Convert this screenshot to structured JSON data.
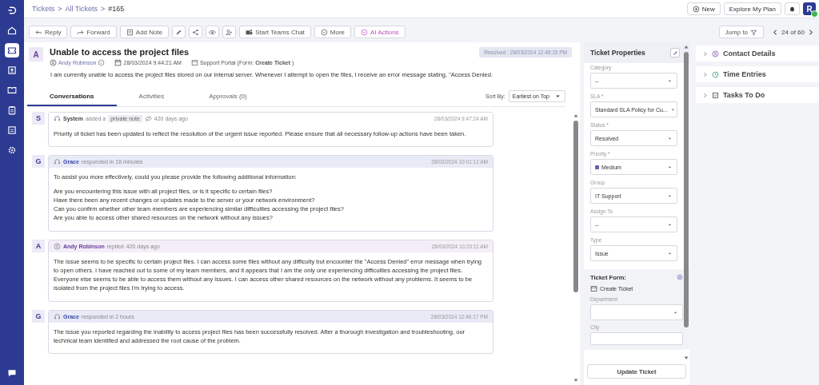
{
  "sidebar": {
    "items": [
      {
        "selected": false
      },
      {
        "selected": false
      },
      {
        "selected": true
      },
      {
        "selected": false
      },
      {
        "selected": false
      },
      {
        "selected": false
      },
      {
        "selected": false
      },
      {
        "selected": false
      }
    ]
  },
  "breadcrumb": {
    "items": [
      "Tickets",
      "All Tickets",
      "#165"
    ],
    "separator": ">"
  },
  "header_buttons": [
    {
      "kind": "new",
      "label": "New"
    },
    {
      "kind": "plain",
      "label": "Explore My Plan"
    },
    {
      "kind": "bell"
    }
  ],
  "user_avatar": {
    "letter": "R",
    "online": true
  },
  "toolbar": {
    "buttons": [
      {
        "kind": "reply",
        "label": "Reply"
      },
      {
        "kind": "forward",
        "label": "Forward"
      },
      {
        "kind": "note",
        "label": "Add Note"
      },
      {
        "kind": "edit"
      },
      {
        "kind": "share"
      },
      {
        "kind": "eye"
      },
      {
        "kind": "users"
      },
      {
        "kind": "teams",
        "label": "Start Teams Chat"
      },
      {
        "kind": "more",
        "label": "More"
      },
      {
        "kind": "ai",
        "label": "AI Actions"
      }
    ],
    "jump_to": "Jump to",
    "pager": "24 of 60"
  },
  "ticket": {
    "avatar": "A",
    "title": "Unable to access the project files",
    "requester": "Andy Robinson",
    "date": "28/03/2024 9:44:21 AM",
    "source": "Support Portal (Form: **Create Ticket**)",
    "status_badge": "Resolved : 28/03/2024 12:48:15 PM",
    "description": "I am currently unable to access the project files stored on our internal server. Whenever I attempt to open the files, I receive an error message stating, \"Access Denied."
  },
  "tabs": [
    {
      "label": "Conversations",
      "selected": true
    },
    {
      "label": "Activities",
      "selected": false
    },
    {
      "label": "Approvals (0)",
      "selected": false
    }
  ],
  "sort": {
    "label": "Sort By:",
    "value": "Earliest on Top"
  },
  "messages": [
    {
      "kind": "note",
      "avatar": "S",
      "author": "System",
      "action": "added a",
      "tag": "private note",
      "ago": "420 days ago",
      "timestamp": "28/03/2024 9:47:24 AM",
      "body": [
        "Priority of ticket has been updated to reflect the resolution of the urgent issue reported. Please ensure that all necessary follow-up actions have been taken."
      ]
    },
    {
      "kind": "agent",
      "avatar": "G",
      "author": "Grace",
      "action": "responded in 16 minutes",
      "timestamp": "28/03/2024 10:01:12 AM",
      "body": [
        "To assist you more effectively, could you please provide the following additional information:",
        "Are you encountering this issue with all project files, or is it specific to certain files?\nHave there been any recent changes or updates made to the server or your network environment?\nCan you confirm whether other team members are experiencing similar difficulties accessing the project files?\nAre you able to access other shared resources on the network without any issues?"
      ]
    },
    {
      "kind": "requester",
      "avatar": "A",
      "author": "Andy Robinson",
      "action": "replied",
      "ago": "420 days ago",
      "timestamp": "28/03/2024 10:20:11 AM",
      "body": [
        "The issue seems to be specific to certain project files. I can access some files without any difficulty but encounter the \"Access Denied\" error message when trying to open others. I have reached out to some of my team members, and it appears that I am the only one experiencing difficulties accessing the project files. Everyone else seems to be able to access them without any issues. I can access other shared resources on the network without any problems. It seems to be isolated from the project files I'm trying to access."
      ]
    },
    {
      "kind": "agent",
      "avatar": "G",
      "author": "Grace",
      "action": "responded in 2 hours",
      "timestamp": "28/03/2024 12:46:17 PM",
      "body": [
        "The issue you reported regarding the inability to access project files has been successfully resolved. After a thorough investigation and troubleshooting, our technical team identified and addressed the root cause of the problem."
      ]
    }
  ],
  "properties": {
    "title": "Ticket Properties",
    "fields": [
      {
        "label": "Category",
        "value": "--"
      },
      {
        "label": "SLA",
        "required_mark": "*",
        "value": "Standard SLA Policy for Cu..."
      },
      {
        "label": "Status",
        "required_mark": "*",
        "value": "Resolved"
      },
      {
        "label": "Priority",
        "required_mark": "*",
        "value": "Medium",
        "color": "#6b5fa8"
      },
      {
        "label": "Group",
        "value": "IT Support"
      },
      {
        "label": "Assign To",
        "value": "--"
      },
      {
        "label": "Type",
        "value": "Issue"
      }
    ],
    "form": {
      "title": "Ticket Form:",
      "name": "Create Ticket",
      "fields": [
        {
          "label": "Department",
          "kind": "select"
        },
        {
          "label": "City",
          "kind": "text"
        }
      ]
    },
    "update_button": "Update Ticket"
  },
  "panels": [
    {
      "kind": "contact",
      "label": "Contact Details",
      "expanded": false
    },
    {
      "kind": "time",
      "label": "Time Entries",
      "expanded": false
    },
    {
      "kind": "tasks",
      "label": "Tasks To Do",
      "expanded": false
    }
  ]
}
